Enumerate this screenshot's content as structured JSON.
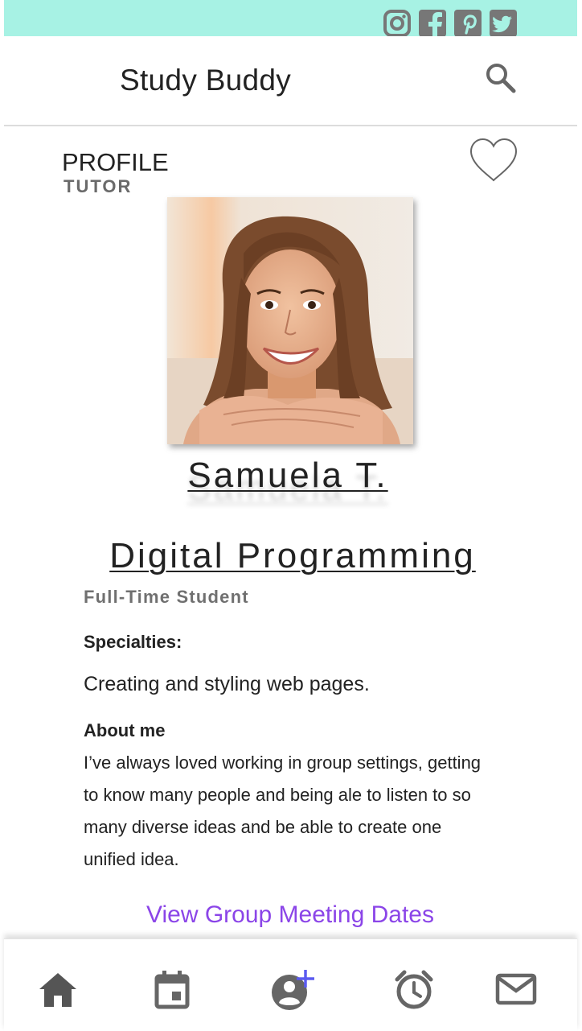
{
  "social_bar": {
    "icons": [
      "instagram-icon",
      "facebook-icon",
      "pinterest-icon",
      "twitter-icon"
    ]
  },
  "header": {
    "title": "Study Buddy",
    "search_icon": "search-icon"
  },
  "profile": {
    "heading": "PROFILE",
    "role": "TUTOR",
    "favorite_icon": "heart-outline-icon",
    "name": "Samuela T.",
    "subject": "Digital Programming",
    "status": "Full-Time Student",
    "specialties_heading": "Specialties:",
    "specialties_text": "Creating and styling web pages.",
    "about_heading": "About me",
    "about_text": "I’ve always loved working in group settings, getting to know many people and being ale to listen to so many diverse ideas and be able to create one unified idea.",
    "meeting_link": "View Group Meeting Dates"
  },
  "bottom_nav": {
    "items": [
      "home-icon",
      "calendar-icon",
      "add-friend-icon",
      "alarm-icon",
      "mail-icon"
    ]
  },
  "colors": {
    "social_bar_bg": "#a7f2e4",
    "accent_link": "#8b45e8",
    "icon_gray": "#666666"
  }
}
